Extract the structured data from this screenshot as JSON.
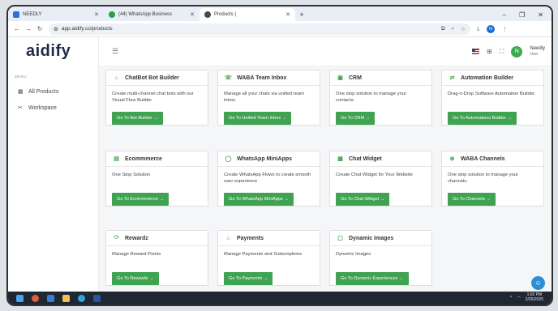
{
  "browser": {
    "tabs": [
      {
        "title": "NEEDLY",
        "color": "#2e6fe0"
      },
      {
        "title": "(44) WhatsApp Business",
        "color": "#25a244"
      },
      {
        "title": "Products |",
        "color": "#4a4a4a"
      }
    ],
    "new_tab": "+",
    "url": "app.aidify.co/products"
  },
  "sidebar": {
    "logo": "aidify",
    "menu_label": "MENU",
    "items": [
      {
        "label": "All Products",
        "icon": "grid-icon"
      },
      {
        "label": "Workspace",
        "icon": "tools-icon"
      }
    ]
  },
  "header": {
    "user_name": "Needly",
    "user_role": "User",
    "avatar_letter": "N"
  },
  "products": [
    {
      "title": "ChatBot Bot Builder",
      "desc": "Create multi-channel chat bots with our Visual Flow Builder",
      "button": "Go To Bot Builder →",
      "icon": "chatbot-icon"
    },
    {
      "title": "WABA Team Inbox",
      "desc": "Manage all your chats via unified team inbox.",
      "button": "Go To Unified Team Inbox →",
      "icon": "inbox-icon"
    },
    {
      "title": "CRM",
      "desc": "One stop solution to manage your contacts.",
      "button": "Go To CRM →",
      "icon": "crm-icon"
    },
    {
      "title": "Automation Builder",
      "desc": "Drag-n-Drop Software Automation Builder.",
      "button": "Go To Automations Builder →",
      "icon": "automation-icon"
    },
    {
      "title": "Ecommmerce",
      "desc": "One Stop Solution",
      "button": "Go To Ecommmerce →",
      "icon": "store-icon"
    },
    {
      "title": "WhatsApp MiniApps",
      "desc": "Create WhatsApp Flows to create smooth user experience",
      "button": "Go To WhatsApp MiniApps →",
      "icon": "whatsapp-icon"
    },
    {
      "title": "Chat Widget",
      "desc": "Create Chat Widget for Your Website",
      "button": "Go To Chat Widget →",
      "icon": "widget-icon"
    },
    {
      "title": "WABA Channels",
      "desc": "One stop solution to manage your channels.",
      "button": "Go To Channels →",
      "icon": "channels-icon"
    },
    {
      "title": "Rewardz",
      "desc": "Manage Reward Points",
      "button": "Go To Rewardz →",
      "icon": "reward-icon"
    },
    {
      "title": "Payments",
      "desc": "Manage Payments and Subscriptions",
      "button": "Go To Payments →",
      "icon": "payments-icon"
    },
    {
      "title": "Dynamic Images",
      "desc": "Dynamic Images",
      "button": "Go To Dynamic Experiences →",
      "icon": "image-icon"
    }
  ],
  "taskbar": {
    "time": "1:02 PM",
    "date": "2/26/2025"
  }
}
